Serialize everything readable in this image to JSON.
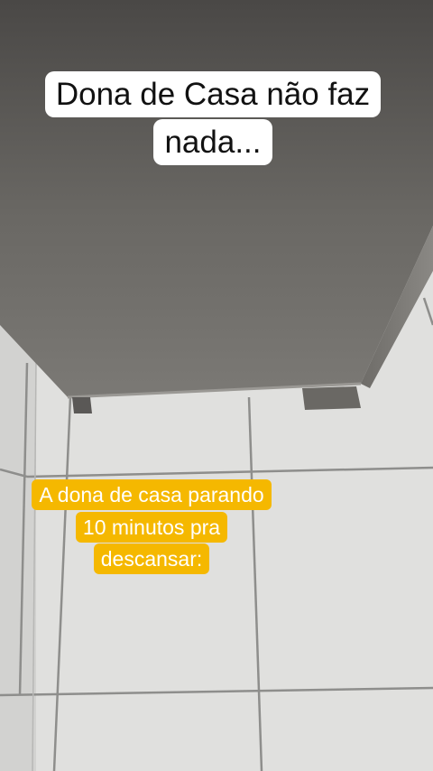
{
  "captions": {
    "top": "Dona de Casa não faz nada...",
    "middle": "A dona de casa parando 10 minutos pra descansar:"
  },
  "colors": {
    "top_caption_bg": "#ffffff",
    "middle_caption_bg": "#f5b800",
    "appliance": "#5f5d5a",
    "floor": "#e0e0de"
  }
}
